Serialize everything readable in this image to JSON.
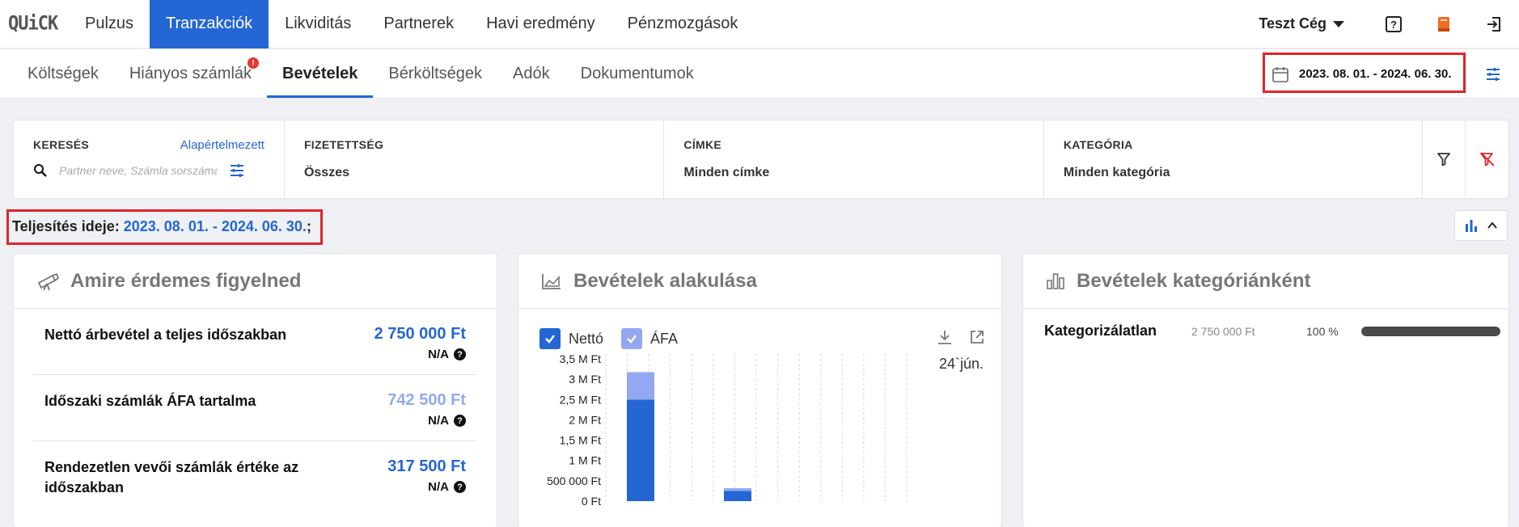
{
  "app": {
    "logo": "QUiCK"
  },
  "topnav": {
    "items": [
      {
        "label": "Pulzus",
        "active": false
      },
      {
        "label": "Tranzakciók",
        "active": true
      },
      {
        "label": "Likviditás",
        "active": false
      },
      {
        "label": "Partnerek",
        "active": false
      },
      {
        "label": "Havi eredmény",
        "active": false
      },
      {
        "label": "Pénzmozgások",
        "active": false
      }
    ],
    "company": "Teszt Cég",
    "icons": [
      "help-icon",
      "book-icon",
      "logout-icon"
    ]
  },
  "subnav": {
    "items": [
      {
        "label": "Költségek",
        "active": false,
        "badge": ""
      },
      {
        "label": "Hiányos számlák",
        "active": false,
        "badge": "!"
      },
      {
        "label": "Bevételek",
        "active": true,
        "badge": ""
      },
      {
        "label": "Bérköltségek",
        "active": false,
        "badge": ""
      },
      {
        "label": "Adók",
        "active": false,
        "badge": ""
      },
      {
        "label": "Dokumentumok",
        "active": false,
        "badge": ""
      }
    ],
    "date_range": "2023. 08. 01. - 2024. 06. 30."
  },
  "filters": {
    "search": {
      "label": "KERESÉS",
      "link": "Alapértelmezett",
      "placeholder": "Partner neve, Számla sorszáma..."
    },
    "payment": {
      "label": "FIZETETTSÉG",
      "value": "Összes"
    },
    "tag": {
      "label": "CÍMKE",
      "value": "Minden címke"
    },
    "category": {
      "label": "KATEGÓRIA",
      "value": "Minden kategória"
    }
  },
  "period": {
    "label": "Teljesítés ideje:",
    "value": "2023. 08. 01. - 2024. 06. 30.",
    "suffix": ";"
  },
  "cards": {
    "kpi": {
      "title": "Amire érdemes figyelned",
      "rows": [
        {
          "label": "Nettó árbevétel a teljes időszakban",
          "value": "2 750 000 Ft",
          "sub": "N/A",
          "color": "#2466d4"
        },
        {
          "label": "Időszaki számlák ÁFA tartalma",
          "value": "742 500 Ft",
          "sub": "N/A",
          "color": "#93a8f0"
        },
        {
          "label": "Rendezetlen vevői számlák értéke az időszakban",
          "value": "317 500 Ft",
          "sub": "N/A",
          "color": "#2466d4"
        }
      ]
    },
    "chart": {
      "title": "Bevételek alakulása",
      "legend": [
        {
          "label": "Nettó",
          "color": "#2466d4"
        },
        {
          "label": "ÁFA",
          "color": "#93a8f0"
        }
      ],
      "month_label": "24`jún."
    },
    "categories": {
      "title": "Bevételek kategóriánként",
      "rows": [
        {
          "name": "Kategorizálatlan",
          "amount": "2 750 000 Ft",
          "pct_label": "100 %",
          "pct": 100
        }
      ]
    }
  },
  "chart_data": {
    "type": "bar",
    "stacked": true,
    "categories": [
      "bar-1",
      "bar-2"
    ],
    "series": [
      {
        "name": "Nettó",
        "values": [
          2500000,
          250000
        ],
        "color": "#2466d4"
      },
      {
        "name": "ÁFA",
        "values": [
          675000,
          67500
        ],
        "color": "#93a8f0"
      }
    ],
    "yticks": [
      "0 Ft",
      "500 000 Ft",
      "1 M Ft",
      "1,5 M Ft",
      "2 M Ft",
      "2,5 M Ft",
      "3 M Ft",
      "3,5 M Ft"
    ],
    "ylim": [
      0,
      3500000
    ],
    "grid": true
  }
}
